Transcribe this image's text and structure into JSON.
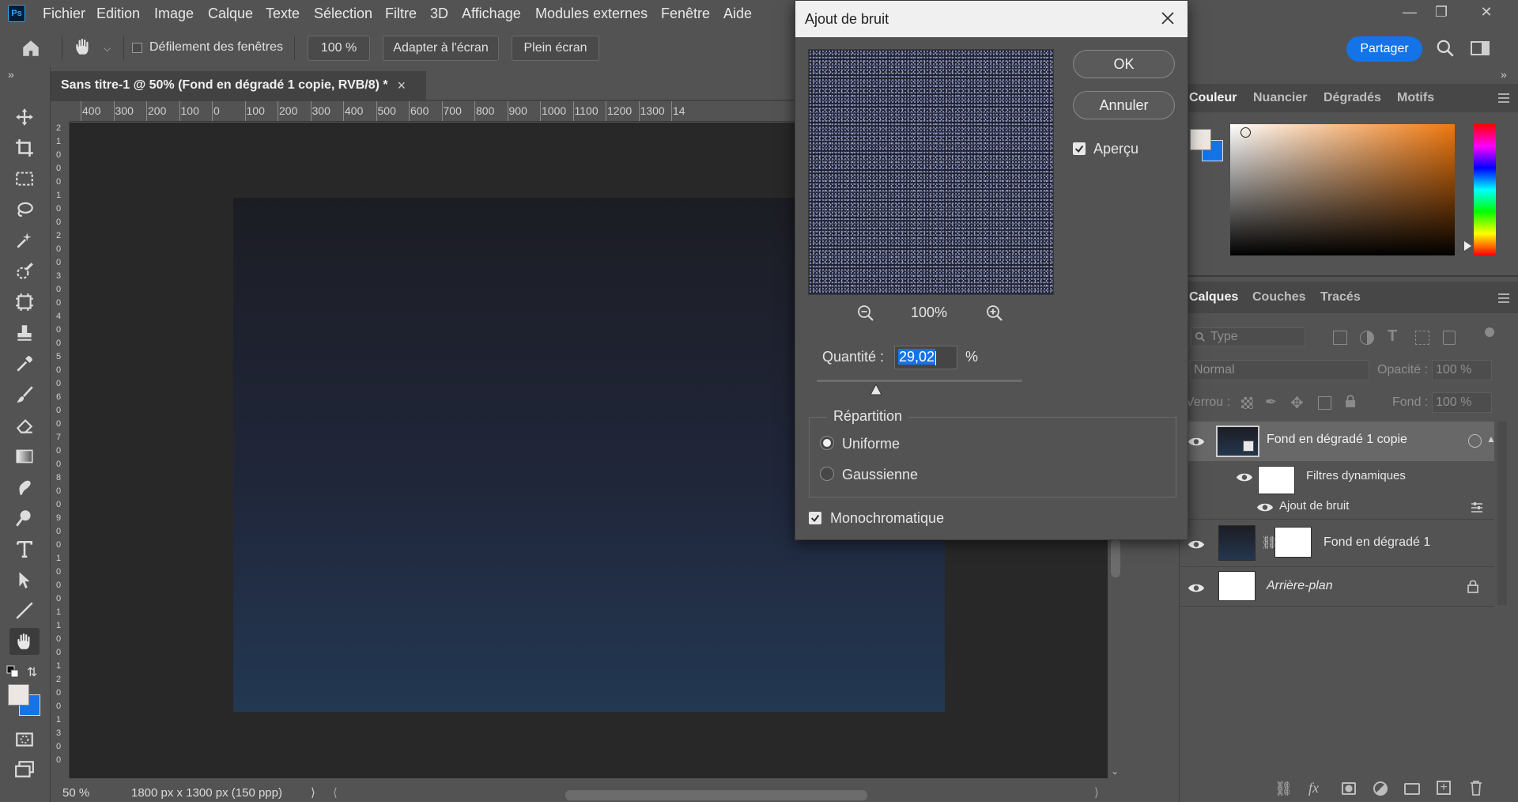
{
  "menubar": {
    "logo": "Ps",
    "items": [
      "Fichier",
      "Edition",
      "Image",
      "Calque",
      "Texte",
      "Sélection",
      "Filtre",
      "3D",
      "Affichage",
      "Modules externes",
      "Fenêtre",
      "Aide"
    ]
  },
  "options": {
    "scroll_all_windows": "Défilement des fenêtres",
    "zoom_value": "100 %",
    "fit_screen": "Adapter à l'écran",
    "fill_screen": "Plein écran",
    "share": "Partager"
  },
  "document": {
    "tab_title": "Sans titre-1 @ 50% (Fond en dégradé 1 copie, RVB/8) *",
    "close": "×",
    "ruler_ticks": [
      "400",
      "300",
      "200",
      "100",
      "0",
      "100",
      "200",
      "300",
      "400",
      "500",
      "600",
      "700",
      "800",
      "900",
      "1000",
      "1100",
      "1200",
      "1300",
      "14"
    ],
    "vruler_ticks": [
      "2",
      "1",
      "0",
      "0",
      "0",
      "1",
      "0",
      "0",
      "2",
      "0",
      "0",
      "3",
      "0",
      "0",
      "4",
      "0",
      "0",
      "5",
      "0",
      "0",
      "6",
      "0",
      "0",
      "7",
      "0",
      "0",
      "8",
      "0",
      "0",
      "9",
      "0",
      "0",
      "1",
      "0",
      "0",
      "0",
      "1",
      "1",
      "0",
      "0",
      "1",
      "2",
      "0",
      "0",
      "1",
      "3",
      "0",
      "0"
    ]
  },
  "status": {
    "zoom": "50 %",
    "dimensions": "1800 px x 1300 px (150 ppp)"
  },
  "color_panel": {
    "tabs": [
      "Couleur",
      "Nuancier",
      "Dégradés",
      "Motifs"
    ],
    "fg_color": "#ece7e3",
    "bg_color": "#1473e6"
  },
  "layers_panel": {
    "tabs": [
      "Calques",
      "Couches",
      "Tracés"
    ],
    "filter_placeholder": "Type",
    "blend_mode": "Normal",
    "opacity_label": "Opacité :",
    "opacity_value": "100 %",
    "lock_label": "Verrou :",
    "fill_label": "Fond :",
    "fill_value": "100 %",
    "layers": [
      {
        "name": "Fond en dégradé 1 copie"
      },
      {
        "name": "Filtres dynamiques"
      },
      {
        "name": "Ajout de bruit"
      },
      {
        "name": "Fond en dégradé 1"
      },
      {
        "name": "Arrière-plan"
      }
    ]
  },
  "dialog": {
    "title": "Ajout de bruit",
    "ok": "OK",
    "cancel": "Annuler",
    "preview_label": "Aperçu",
    "preview_checked": true,
    "zoom": "100%",
    "amount_label": "Quantité :",
    "amount_value": "29,02",
    "amount_unit": "%",
    "amount_slider_fraction": 0.29,
    "distribution_label": "Répartition",
    "distribution_options": [
      "Uniforme",
      "Gaussienne"
    ],
    "distribution_selected": "Uniforme",
    "mono_label": "Monochromatique",
    "mono_checked": true
  }
}
